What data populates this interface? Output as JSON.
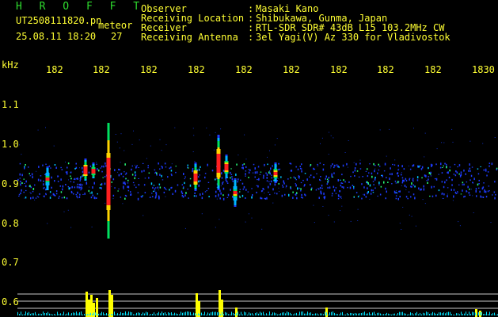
{
  "header": {
    "title": "H R O F F T",
    "filename": "UT2508111820.pn",
    "meteor_label": "meteor",
    "datetime": "25.08.11 18:20",
    "count": "27",
    "fields": [
      {
        "label": "Observer",
        "value": "Masaki Kano"
      },
      {
        "label": "Receiving Location",
        "value": "Shibukawa, Gunma, Japan"
      },
      {
        "label": "Receiver",
        "value": "RTL-SDR SDR# 43dB L15 103.2MHz CW"
      },
      {
        "label": "Receiving Antenna",
        "value": "3el Yagi(V) Az 330 for Vladivostok"
      }
    ]
  },
  "axes": {
    "y_unit": "kHz",
    "y_ticks": [
      "1.1",
      "1.0",
      "0.9",
      "0.8",
      "0.7",
      "0.6"
    ],
    "time_ticks": [
      "182",
      "182",
      "182",
      "182",
      "182",
      "182",
      "182",
      "182",
      "182",
      "1830"
    ]
  },
  "colors": {
    "background": "#000000",
    "text": "#ffff33",
    "title": "#2fdc2f",
    "noise": "#1e3cff",
    "histogram": "#ffff00",
    "baseline": "#00e5ff",
    "grid": "#c8c8c8"
  }
}
